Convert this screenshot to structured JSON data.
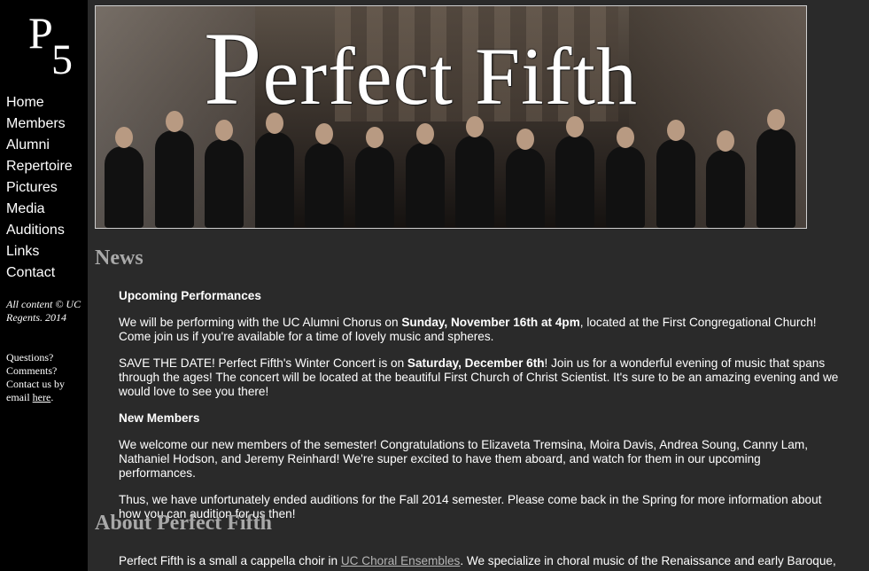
{
  "logo": {
    "p": "P",
    "five": "5"
  },
  "nav": {
    "items": [
      "Home",
      "Members",
      "Alumni",
      "Repertoire",
      "Pictures",
      "Media",
      "Auditions",
      "Links",
      "Contact"
    ]
  },
  "sidebar": {
    "copyright": "All content © UC Regents. 2014",
    "questions_text": "Questions? Comments? Contact us by email ",
    "questions_link": "here",
    "questions_end": "."
  },
  "banner": {
    "title_p": "P",
    "title_rest": "erfect Fifth"
  },
  "news": {
    "heading": "News",
    "upcoming_title": "Upcoming Performances",
    "p1_a": "We will be performing with the UC Alumni Chorus on ",
    "p1_b": "Sunday, November 16th at 4pm",
    "p1_c": ", located at the First Congregational Church! Come join us if you're available for a time of lovely music and spheres.",
    "p2_a": "SAVE THE DATE! Perfect Fifth's Winter Concert is on ",
    "p2_b": "Saturday, December 6th",
    "p2_c": "! Join us for a wonderful evening of music that spans through the ages! The concert will be located at the beautiful First Church of Christ Scientist. It's sure to be an amazing evening and we would love to see you there!",
    "members_title": "New Members",
    "p3": "We welcome our new members of the semester! Congratulations to Elizaveta Tremsina, Moira Davis, Andrea Soung, Canny Lam, Nathaniel Hodson, and Jeremy Reinhard! We're super excited to have them aboard, and watch for them in our upcoming performances.",
    "p4": "Thus, we have unfortunately ended auditions for the Fall 2014 semester. Please come back in the Spring for more information about how you can audition for us then!"
  },
  "about": {
    "heading": "About Perfect Fifth",
    "p1_a": "Perfect Fifth is a small a cappella choir in ",
    "p1_link": "UC Choral Ensembles",
    "p1_b": ". We specialize in choral music of the Renaissance and early Baroque,"
  }
}
